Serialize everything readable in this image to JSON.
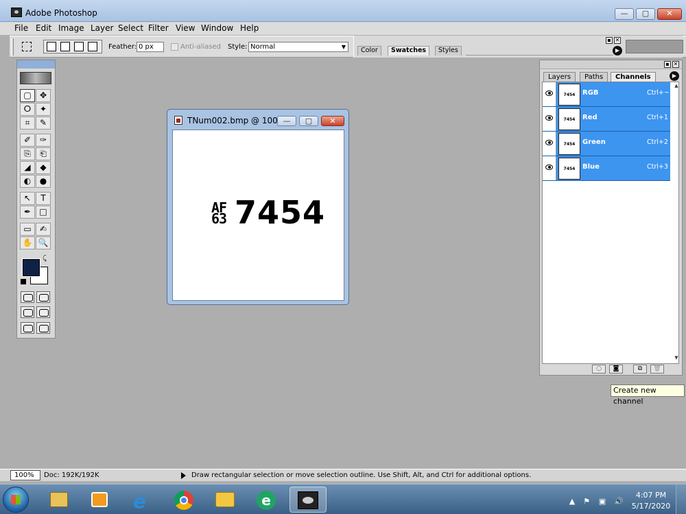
{
  "window": {
    "title": "Adobe Photoshop",
    "buttons": {
      "minimize": "—",
      "maximize": "▢",
      "close": "✕"
    }
  },
  "menu": [
    "File",
    "Edit",
    "Image",
    "Layer",
    "Select",
    "Filter",
    "View",
    "Window",
    "Help"
  ],
  "options": {
    "feather_label": "Feather:",
    "feather_value": "0 px",
    "antialias_label": "Anti-aliased",
    "style_label": "Style:",
    "style_value": "Normal"
  },
  "palette_well": {
    "tabs": [
      "Color",
      "Swatches",
      "Styles"
    ],
    "active": "Swatches"
  },
  "tools": [
    "▢",
    "✥",
    "ⵔ",
    "✦",
    "⌗",
    "✎",
    "✐",
    "✑",
    "⎘",
    "⎗",
    "◢",
    "◆",
    "◐",
    "●",
    "↖",
    "T",
    "✒",
    "□",
    "▭",
    "✍",
    "✋",
    "🔍"
  ],
  "document": {
    "title": "TNum002.bmp @ 100...",
    "plate_top": "AF",
    "plate_bottom": "63",
    "plate_number": "7454"
  },
  "channels_palette": {
    "tabs": [
      "Layers",
      "Paths",
      "Channels"
    ],
    "active": "Channels",
    "thumb_text": "7454",
    "channels": [
      {
        "name": "RGB",
        "shortcut": "Ctrl+~"
      },
      {
        "name": "Red",
        "shortcut": "Ctrl+1"
      },
      {
        "name": "Green",
        "shortcut": "Ctrl+2"
      },
      {
        "name": "Blue",
        "shortcut": "Ctrl+3"
      }
    ]
  },
  "tooltip": "Create new channel",
  "status": {
    "zoom": "100%",
    "doc": "Doc: 192K/192K",
    "message": "Draw rectangular selection or move selection outline.  Use Shift, Alt, and Ctrl for additional options."
  },
  "taskbar": {
    "time": "4:07 PM",
    "date": "5/17/2020",
    "apps": [
      "file-explorer",
      "media-player",
      "internet-explorer",
      "chrome",
      "outlook",
      "edge",
      "photoshop"
    ]
  }
}
